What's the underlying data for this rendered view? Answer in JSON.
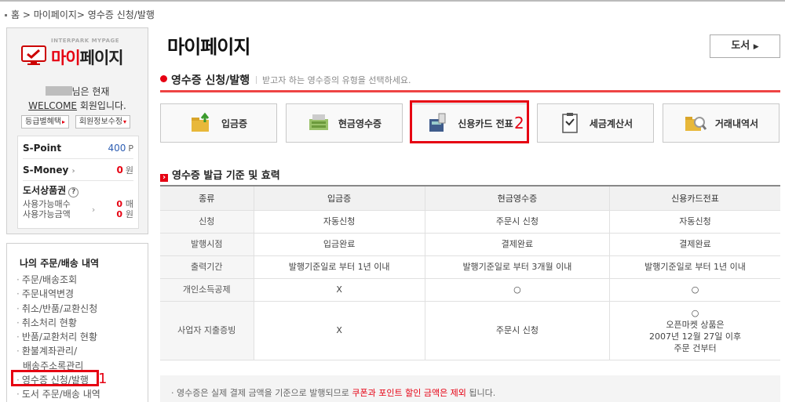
{
  "breadcrumb": "홈 > 마이페이지> 영수증 신청/발행",
  "sidebar": {
    "logo_small": "INTERPARK MYPAGE",
    "logo_big_red": "마이",
    "logo_big_black": "페이지",
    "greeting_suffix": "님은 현재",
    "welcome_label": "WELCOME",
    "member_suffix": " 회원입니다.",
    "btn_grade": "등급별혜택",
    "btn_info": "회원정보수정",
    "spoint_label": "S-Point",
    "spoint_value": "400",
    "spoint_unit": "P",
    "smoney_label": "S-Money",
    "smoney_value": "0",
    "smoney_unit": "원",
    "gift_title": "도서상품권",
    "gift_count_label": "사용가능매수",
    "gift_amount_label": "사용가능금액",
    "gift_count_value": "0",
    "gift_count_unit": "매",
    "gift_amount_value": "0",
    "gift_amount_unit": "원",
    "order_title": "나의 주문/배송 내역",
    "order_items": [
      "주문/배송조회",
      "주문내역변경",
      "취소/반품/교환신청",
      "취소처리 현황",
      "반품/교환처리 현황",
      "환불계좌관리/",
      "배송주소록관리",
      "영수증 신청/발행",
      "도서 주문/배송 내역"
    ],
    "marker_1": "1"
  },
  "main": {
    "title": "마이페이지",
    "book_button": "도서",
    "section_title": "영수증 신청/발행",
    "section_sub": "받고자 하는 영수증의 유형을 선택하세요.",
    "receipt_buttons": [
      "입금증",
      "현금영수증",
      "신용카드 전표",
      "세금계산서",
      "거래내역서"
    ],
    "marker_2": "2",
    "sub_title": "영수증 발급 기준 및 효력"
  },
  "table": {
    "headers": [
      "종류",
      "입금증",
      "현금영수증",
      "신용카드전표"
    ],
    "rows": [
      [
        "신청",
        "자동신청",
        "주문시 신청",
        "자동신청"
      ],
      [
        "발행시점",
        "입금완료",
        "결제완료",
        "결제완료"
      ],
      [
        "출력기간",
        "발행기준일로 부터 1년 이내",
        "발행기준일로 부터 3개월 이내",
        "발행기준일로 부터 1년 이내"
      ],
      [
        "개인소득공제",
        "X",
        "○",
        "○"
      ],
      [
        "사업자 지출증빙",
        "X",
        "주문시 신청",
        "○"
      ]
    ],
    "card_biz_line2": "오픈마켓 상품은",
    "card_biz_line3": "2007년 12월 27일 이후",
    "card_biz_line4": "주문 건부터"
  },
  "note": {
    "prefix": "· 영수증은 실제 결제 금액을 기준으로 발행되므로 ",
    "highlight": "쿠폰과 포인트 할인 금액은 제외",
    "suffix": " 됩니다."
  }
}
